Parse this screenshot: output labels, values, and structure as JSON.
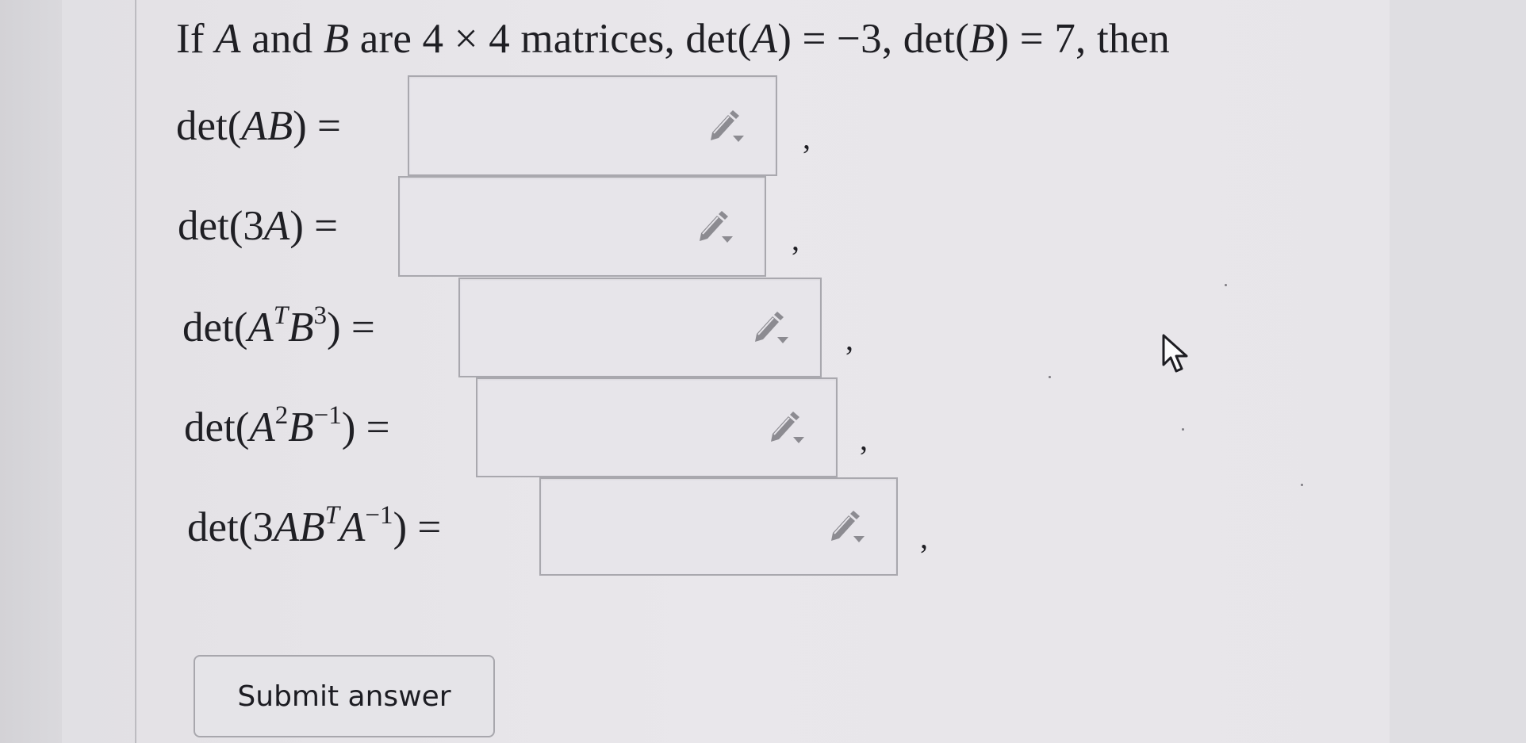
{
  "question": {
    "prompt_parts": [
      "If ",
      "A",
      " and ",
      "B",
      " are 4 × 4 matrices, det(",
      "A",
      ") = −3, det(",
      "B",
      ") = 7, then"
    ]
  },
  "answers": [
    {
      "label_html": "det(<i>AB</i>) =",
      "value": "",
      "comma": ","
    },
    {
      "label_html": "det(3<i>A</i>) =",
      "value": "",
      "comma": ","
    },
    {
      "label_html": "det(<i>A</i><sup><i>T</i></sup><i>B</i><sup>3</sup>) =",
      "value": "",
      "comma": ","
    },
    {
      "label_html": "det(<i>A</i><sup>2</sup><i>B</i><sup>−1</sup>) =",
      "value": "",
      "comma": ","
    },
    {
      "label_html": "det(3<i>AB</i><sup><i>T</i></sup><i>A</i><sup>−1</sup>) =",
      "value": "",
      "comma": ","
    }
  ],
  "submit": {
    "label": "Submit answer"
  },
  "icons": {
    "answer_tool": "pencil-icon",
    "pointer": "mouse-cursor-icon"
  },
  "colors": {
    "box_border": "#a9a8ae",
    "box_fill": "#e7e5ea",
    "icon_gray": "#8c8b91"
  }
}
